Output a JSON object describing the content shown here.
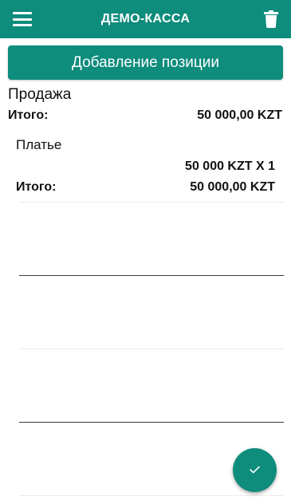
{
  "app_bar": {
    "title": "ДЕМО-КАССА",
    "menu_icon": "hamburger-menu-icon",
    "delete_icon": "trash-icon"
  },
  "add_position_button": {
    "label": "Добавление позиции"
  },
  "sale": {
    "heading": "Продажа",
    "total_label": "Итого:",
    "total_value": "50 000,00 KZT"
  },
  "items": [
    {
      "name": "Платье",
      "price_qty": "50 000 KZT X 1",
      "total_label": "Итого:",
      "total_value": "50 000,00 KZT"
    }
  ],
  "fab": {
    "icon": "checkmark-icon"
  },
  "colors": {
    "primary": "#0e8c7c",
    "on_primary": "#ffffff",
    "text": "#111111",
    "divider_light": "#ececec",
    "divider_dark": "#3a3a3a"
  }
}
